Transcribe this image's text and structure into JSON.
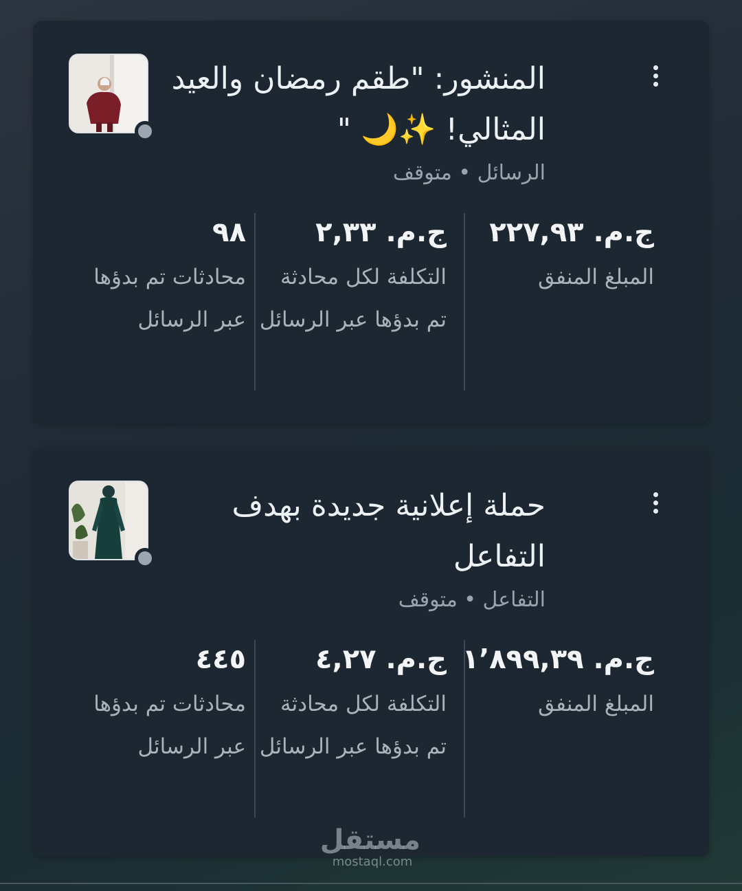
{
  "campaigns": [
    {
      "title": "المنشور: \"طقم رمضان والعيد المثالي! ✨🌙 \"",
      "subtitle": "الرسائل • متوقف",
      "menu_icon": "more-vertical-icon",
      "status_color": "#9ba6b1",
      "metrics": [
        {
          "value": "ج.م. ٢٢٧,٩٣",
          "label": "المبلغ المنفق"
        },
        {
          "value": "ج.م. ٢,٣٣",
          "label": "التكلفة لكل محادثة تم بدؤها عبر الرسائل"
        },
        {
          "value": "٩٨",
          "label": "محادثات تم بدؤها عبر الرسائل"
        }
      ]
    },
    {
      "title": "حملة إعلانية جديدة بهدف التفاعل",
      "subtitle": "التفاعل • متوقف",
      "menu_icon": "more-vertical-icon",
      "status_color": "#9ba6b1",
      "metrics": [
        {
          "value": "ج.م. ١٬٨٩٩,٣٩",
          "label": "المبلغ المنفق"
        },
        {
          "value": "ج.م. ٤,٢٧",
          "label": "التكلفة لكل محادثة تم بدؤها عبر الرسائل"
        },
        {
          "value": "٤٤٥",
          "label": "محادثات تم بدؤها عبر الرسائل"
        }
      ]
    }
  ],
  "watermark": {
    "logo": "مستقل",
    "url": "mostaql.com"
  }
}
